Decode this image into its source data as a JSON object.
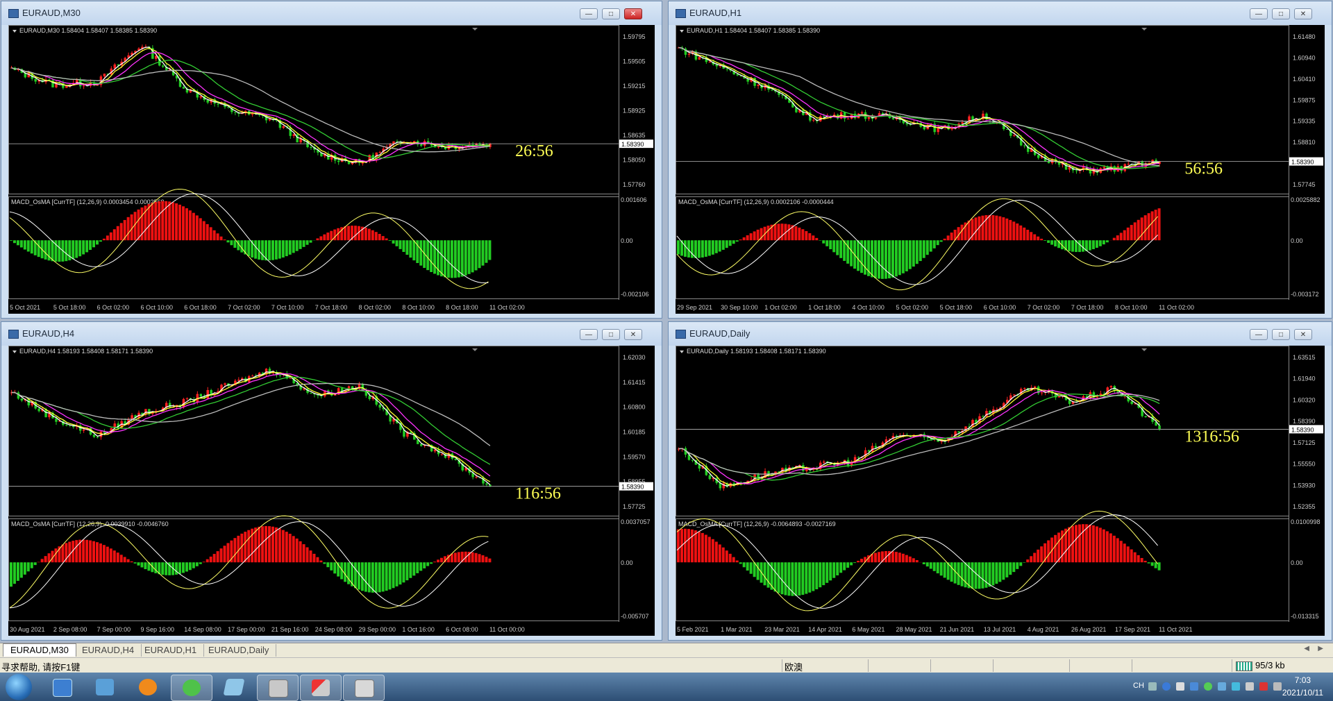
{
  "windows": [
    {
      "title": "EURAUD,M30",
      "info": "EURAUD,M30  1.58404 1.58407 1.58385 1.58390",
      "price_labels": [
        "1.59795",
        "1.59505",
        "1.59215",
        "1.58925",
        "1.58635",
        "1.58050",
        "1.57760"
      ],
      "current_price": "1.58390",
      "countdown": "26:56",
      "macd_info": "MACD_OsMA [CurrTF] (12,26,9) 0.0003454 0.0002569",
      "macd_labels": [
        "0.001606",
        "0.00",
        "-0.002106"
      ],
      "time_labels": [
        "5 Oct 2021",
        "5 Oct 18:00",
        "6 Oct 02:00",
        "6 Oct 10:00",
        "6 Oct 18:00",
        "7 Oct 02:00",
        "7 Oct 10:00",
        "7 Oct 18:00",
        "8 Oct 02:00",
        "8 Oct 10:00",
        "8 Oct 18:00",
        "11 Oct 02:00"
      ],
      "has_close": true
    },
    {
      "title": "EURAUD,H1",
      "info": "EURAUD,H1  1.58404 1.58407 1.58385 1.58390",
      "price_labels": [
        "1.61480",
        "1.60940",
        "1.60410",
        "1.59875",
        "1.59335",
        "1.58810",
        "1.58270",
        "1.57745"
      ],
      "current_price": "1.58390",
      "countdown": "56:56",
      "macd_info": "MACD_OsMA [CurrTF] (12,26,9) 0.0002106 -0.0000444",
      "macd_labels": [
        "0.0025882",
        "0.00",
        "-0.003172"
      ],
      "time_labels": [
        "29 Sep 2021",
        "30 Sep 10:00",
        "1 Oct 02:00",
        "1 Oct 18:00",
        "4 Oct 10:00",
        "5 Oct 02:00",
        "5 Oct 18:00",
        "6 Oct 10:00",
        "7 Oct 02:00",
        "7 Oct 18:00",
        "8 Oct 10:00",
        "11 Oct 02:00"
      ],
      "has_close": false
    },
    {
      "title": "EURAUD,H4",
      "info": "EURAUD,H4  1.58193 1.58408 1.58171 1.58390",
      "price_labels": [
        "1.62030",
        "1.61415",
        "1.60800",
        "1.60185",
        "1.59570",
        "1.58955",
        "1.57725"
      ],
      "current_price": "1.58390",
      "countdown": "116:56",
      "macd_info": "MACD_OsMA [CurrTF] (12,26,9) -0.0039910 -0.0046760",
      "macd_labels": [
        "0.0037057",
        "0.00",
        "-0.005707"
      ],
      "time_labels": [
        "30 Aug 2021",
        "2 Sep 08:00",
        "7 Sep 00:00",
        "9 Sep 16:00",
        "14 Sep 08:00",
        "17 Sep 00:00",
        "21 Sep 16:00",
        "24 Sep 08:00",
        "29 Sep 00:00",
        "1 Oct 16:00",
        "6 Oct 08:00",
        "11 Oct 00:00"
      ],
      "has_close": false
    },
    {
      "title": "EURAUD,Daily",
      "info": "EURAUD,Daily  1.58193 1.58408 1.58171 1.58390",
      "price_labels": [
        "1.63515",
        "1.61940",
        "1.60320",
        "1.58390",
        "1.57125",
        "1.55550",
        "1.53930",
        "1.52355"
      ],
      "current_price": "1.58390",
      "countdown": "1316:56",
      "macd_info": "MACD_OsMA [CurrTF] (12,26,9) -0.0064893 -0.0027169",
      "macd_labels": [
        "0.0100998",
        "0.00",
        "-0.013315"
      ],
      "time_labels": [
        "5 Feb 2021",
        "1 Mar 2021",
        "23 Mar 2021",
        "14 Apr 2021",
        "6 May 2021",
        "28 May 2021",
        "21 Jun 2021",
        "13 Jul 2021",
        "4 Aug 2021",
        "26 Aug 2021",
        "17 Sep 2021",
        "11 Oct 2021"
      ],
      "has_close": false
    }
  ],
  "chart_data": [
    {
      "type": "line",
      "title": "EURAUD,M30",
      "ylim": [
        1.5776,
        1.5999
      ],
      "x": [
        "5 Oct 2021",
        "5 Oct 18:00",
        "6 Oct 02:00",
        "6 Oct 10:00",
        "6 Oct 18:00",
        "7 Oct 02:00",
        "7 Oct 10:00",
        "7 Oct 18:00",
        "8 Oct 02:00",
        "8 Oct 10:00",
        "8 Oct 18:00",
        "11 Oct 02:00"
      ],
      "series": [
        {
          "values": [
            1.5948,
            1.5925,
            1.593,
            1.5985,
            1.592,
            1.5888,
            1.5875,
            1.5825,
            1.581,
            1.5845,
            1.5835,
            1.5839
          ]
        }
      ]
    },
    {
      "type": "line",
      "title": "EURAUD,H1",
      "ylim": [
        1.5774,
        1.6165
      ],
      "x": [
        "29 Sep 2021",
        "30 Sep 10:00",
        "1 Oct 02:00",
        "1 Oct 18:00",
        "4 Oct 10:00",
        "5 Oct 02:00",
        "5 Oct 18:00",
        "6 Oct 10:00",
        "7 Oct 02:00",
        "7 Oct 18:00",
        "8 Oct 10:00",
        "11 Oct 02:00"
      ],
      "series": [
        {
          "values": [
            1.613,
            1.608,
            1.603,
            1.595,
            1.596,
            1.595,
            1.592,
            1.596,
            1.587,
            1.5815,
            1.582,
            1.5839
          ]
        }
      ]
    },
    {
      "type": "line",
      "title": "EURAUD,H4",
      "ylim": [
        1.5772,
        1.623
      ],
      "x": [
        "30 Aug 2021",
        "2 Sep 08:00",
        "7 Sep 00:00",
        "9 Sep 16:00",
        "14 Sep 08:00",
        "17 Sep 00:00",
        "21 Sep 16:00",
        "24 Sep 08:00",
        "29 Sep 00:00",
        "1 Oct 16:00",
        "6 Oct 08:00",
        "11 Oct 00:00"
      ],
      "series": [
        {
          "values": [
            1.612,
            1.604,
            1.599,
            1.606,
            1.609,
            1.614,
            1.619,
            1.611,
            1.614,
            1.6,
            1.593,
            1.5839
          ]
        }
      ]
    },
    {
      "type": "line",
      "title": "EURAUD,Daily",
      "ylim": [
        1.5235,
        1.64
      ],
      "x": [
        "5 Feb 2021",
        "1 Mar 2021",
        "23 Mar 2021",
        "14 Apr 2021",
        "6 May 2021",
        "28 May 2021",
        "21 Jun 2021",
        "13 Jul 2021",
        "4 Aug 2021",
        "26 Aug 2021",
        "17 Sep 2021",
        "11 Oct 2021"
      ],
      "series": [
        {
          "values": [
            1.57,
            1.54,
            1.55,
            1.555,
            1.56,
            1.58,
            1.575,
            1.595,
            1.615,
            1.605,
            1.615,
            1.5839
          ]
        }
      ]
    }
  ],
  "tabs": [
    "EURAUD,M30",
    "EURAUD,H4",
    "EURAUD,H1",
    "EURAUD,Daily"
  ],
  "status": {
    "help": "寻求帮助, 请按F1键",
    "profile": "欧澳",
    "traffic": "95/3 kb"
  },
  "clock": {
    "time": "7:03",
    "date": "2021/10/11"
  },
  "tray_lang": "CH"
}
